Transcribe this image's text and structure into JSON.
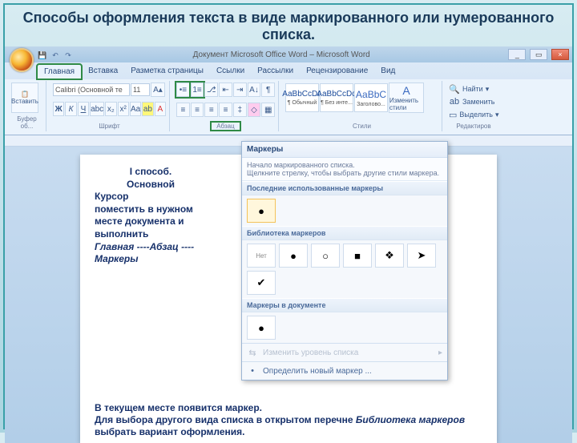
{
  "slide": {
    "title": "Способы оформления текста в виде  маркированного или нумерованного списка."
  },
  "window": {
    "caption": "Документ Microsoft Office Word – Microsoft Word",
    "min": "_",
    "max": "▭",
    "close": "×"
  },
  "tabs": {
    "home": "Главная",
    "insert": "Вставка",
    "layout": "Разметка страницы",
    "refs": "Ссылки",
    "mail": "Рассылки",
    "review": "Рецензирование",
    "view": "Вид"
  },
  "clipboard": {
    "paste": "Вставить",
    "group": "Буфер об..."
  },
  "font": {
    "name": "Calibri (Основной те",
    "size": "11",
    "group": "Шрифт"
  },
  "paragraph": {
    "group": "Абзац"
  },
  "styles": {
    "s1": {
      "samp": "АаВbСсDd",
      "name": "¶ Обычный"
    },
    "s2": {
      "samp": "АаВbСсDd",
      "name": "¶ Без инте..."
    },
    "s3": {
      "samp": "АаВbС",
      "name": "Заголово..."
    },
    "change": "Изменить стили",
    "group": "Стили"
  },
  "editing": {
    "find": "Найти",
    "replace": "Заменить",
    "select": "Выделить",
    "group": "Редактиров"
  },
  "instruction": {
    "l1": "I  способ.",
    "l2": "Основной",
    "l3": "Курсор",
    "l4": "поместить в нужном месте документа и выполнить",
    "l5": "Главная ----Абзац  ----Маркеры"
  },
  "footnote": {
    "l1": "В текущем месте появится маркер.",
    "l2_a": "Для выбора другого вида списка  в открытом перечне ",
    "l2_b": "Библиотека маркеров",
    "l2_c": " выбрать вариант оформления."
  },
  "popup": {
    "title": "Маркеры",
    "hint1": "Начало маркированного списка.",
    "hint2": "Щелкните стрелку, чтобы выбрать другие стили маркера.",
    "recent": "Последние использованные маркеры",
    "library": "Библиотека маркеров",
    "indoc": "Маркеры в документе",
    "none": "Нет",
    "level": "Изменить уровень списка",
    "define": "Определить новый маркер ..."
  },
  "glyphs": {
    "dot": "●",
    "circle": "○",
    "square": "■",
    "diamond4": "❖",
    "arrow": "➤",
    "check": "✔",
    "chev": "▸",
    "dd": "▾"
  }
}
